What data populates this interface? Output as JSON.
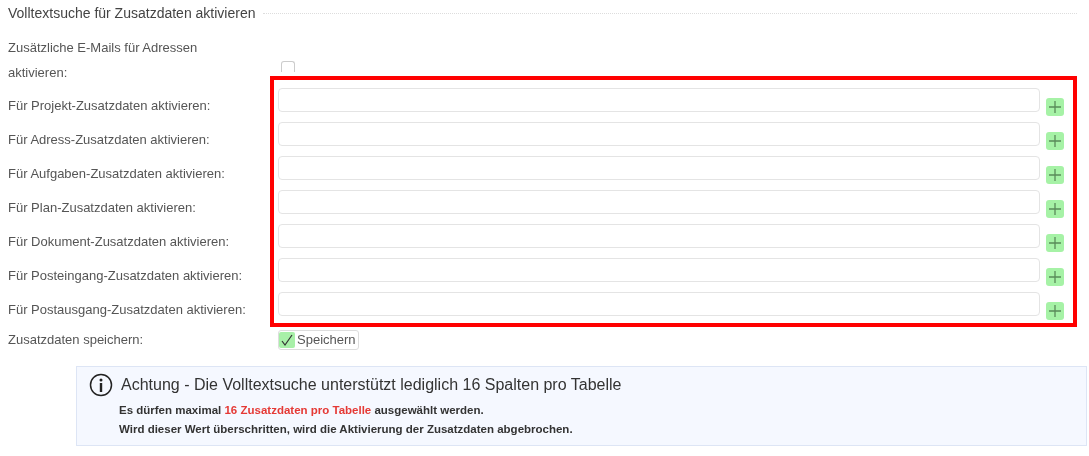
{
  "section_title": "Volltextsuche für Zusatzdaten aktivieren",
  "email_option": {
    "label": "Zusätzliche E-Mails für Adressen aktivieren:",
    "checked": false
  },
  "rows": [
    {
      "label": "Für Projekt-Zusatzdaten aktivieren:"
    },
    {
      "label": "Für Adress-Zusatzdaten aktivieren:"
    },
    {
      "label": "Für Aufgaben-Zusatzdaten aktivieren:"
    },
    {
      "label": "Für Plan-Zusatzdaten aktivieren:"
    },
    {
      "label": "Für Dokument-Zusatzdaten aktivieren:"
    },
    {
      "label": "Für Posteingang-Zusatzdaten aktivieren:"
    },
    {
      "label": "Für Postausgang-Zusatzdaten aktivieren:"
    }
  ],
  "save": {
    "label": "Zusatzdaten speichern:",
    "button": "Speichern"
  },
  "note": {
    "title": "Achtung - Die Volltextsuche unterstützt lediglich 16 Spalten pro Tabelle",
    "lines": [
      [
        {
          "text": "Es dürfen maximal ",
          "emphasis": false
        },
        {
          "text": "16 Zusatzdaten pro Tabelle",
          "emphasis": true
        },
        {
          "text": " ausgewählt werden.",
          "emphasis": false
        }
      ],
      [
        {
          "text": "Wird dieser Wert überschritten, wird die Aktivierung der Zusatzdaten abgebrochen.",
          "emphasis": false
        }
      ]
    ]
  }
}
